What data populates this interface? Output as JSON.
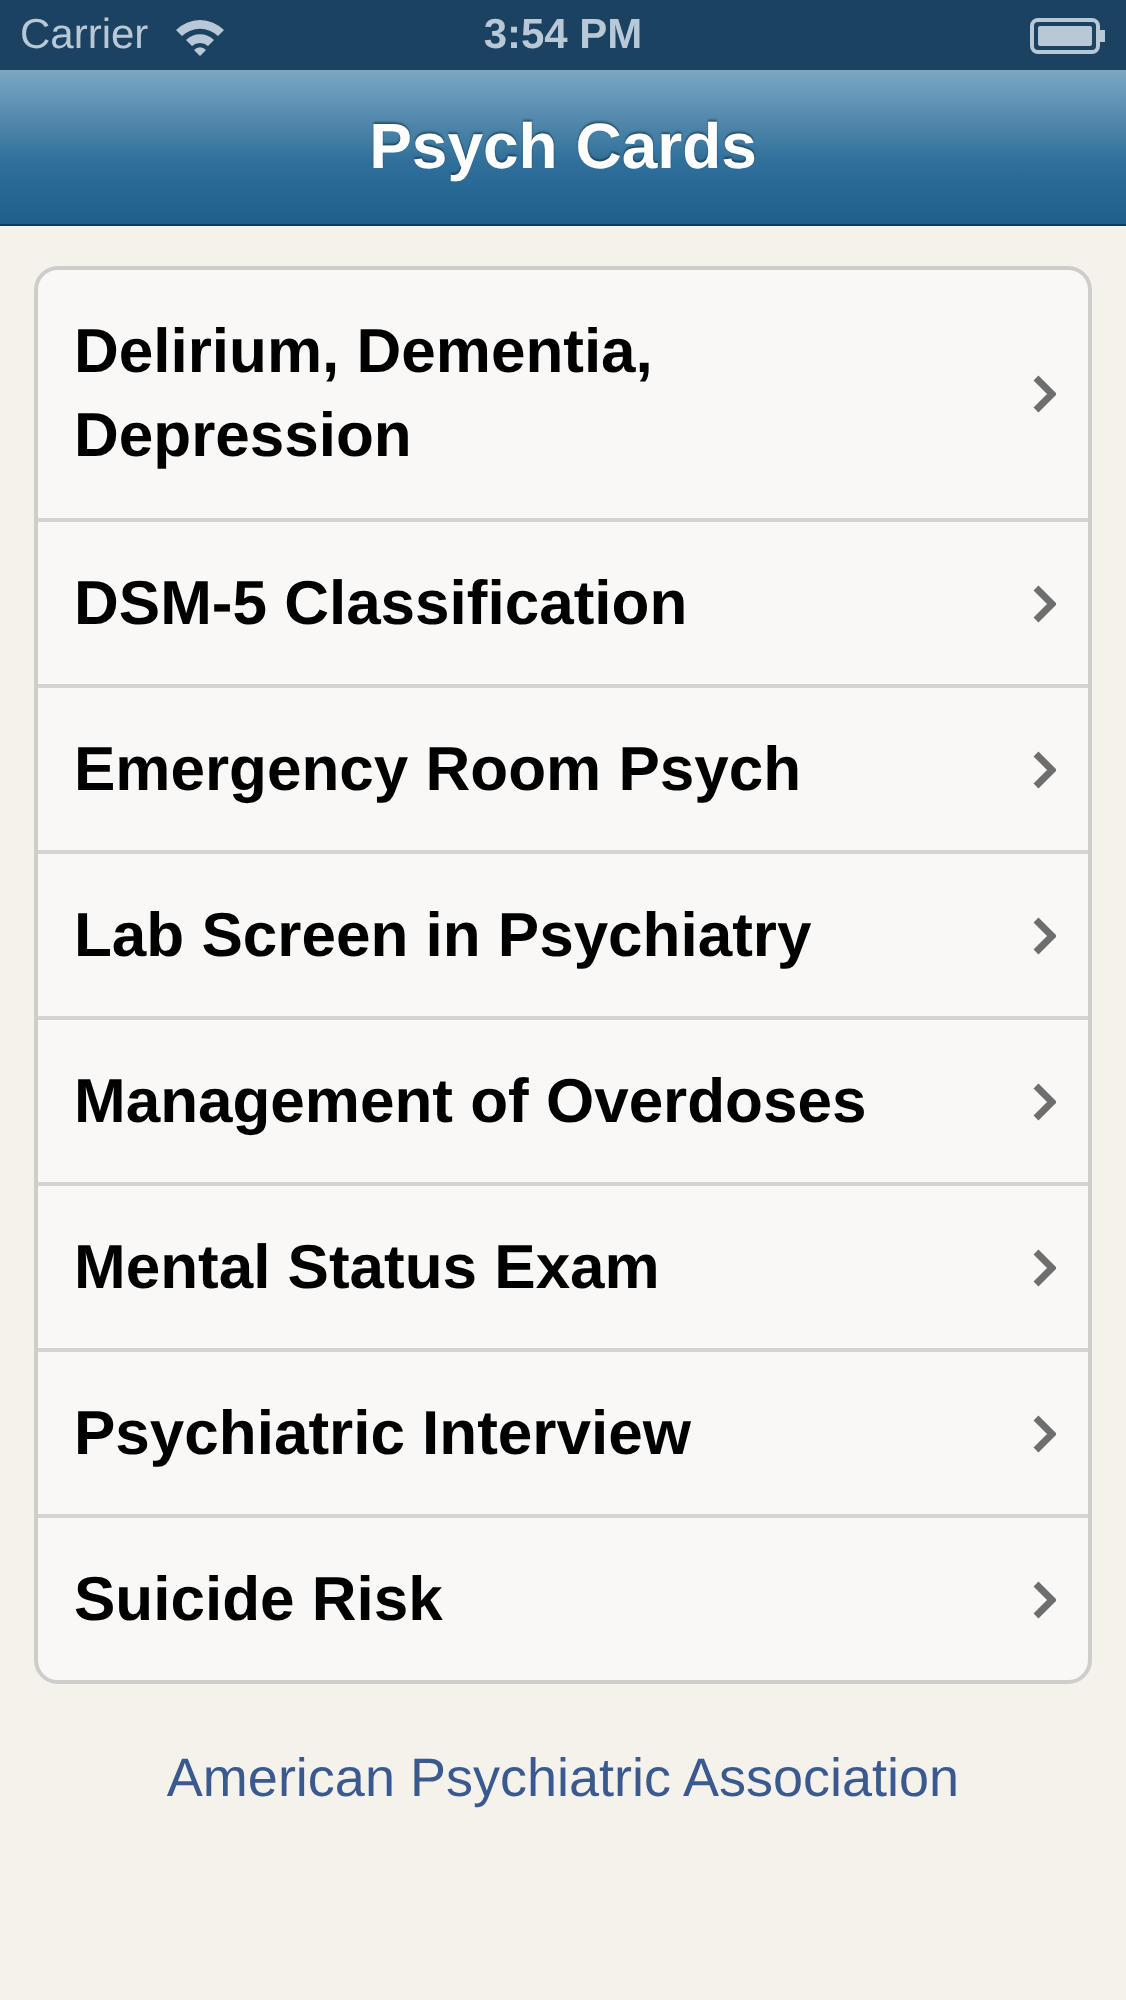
{
  "status_bar": {
    "carrier": "Carrier",
    "time": "3:54 PM"
  },
  "nav_bar": {
    "title": "Psych Cards"
  },
  "list": {
    "items": [
      {
        "label": "Delirium, Dementia, Depression"
      },
      {
        "label": "DSM-5 Classification"
      },
      {
        "label": "Emergency Room Psych"
      },
      {
        "label": "Lab Screen in Psychiatry"
      },
      {
        "label": "Management of Overdoses"
      },
      {
        "label": "Mental Status Exam"
      },
      {
        "label": "Psychiatric Interview"
      },
      {
        "label": "Suicide Risk"
      }
    ]
  },
  "footer": {
    "link": "American Psychiatric Association"
  }
}
